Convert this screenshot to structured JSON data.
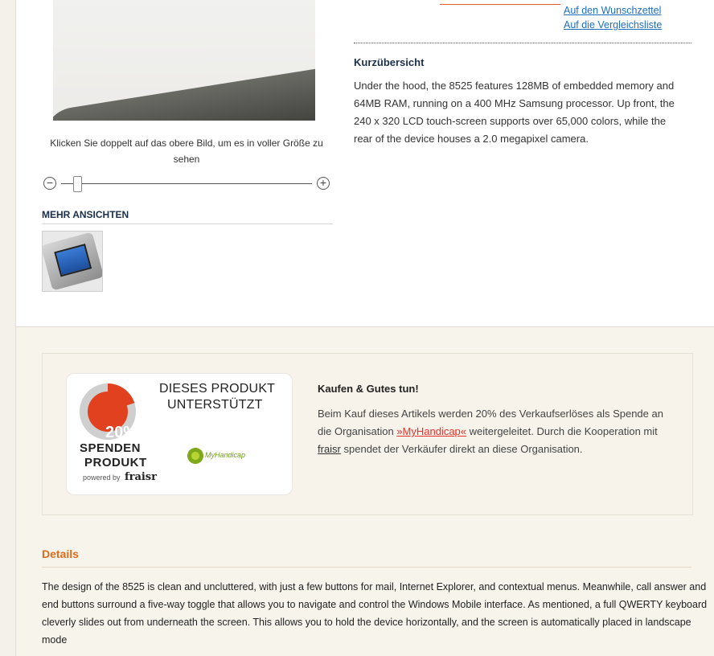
{
  "media": {
    "zoom_hint": "Klicken Sie doppelt auf das obere Bild, um es in voller Größe zu sehen",
    "zoom_out_symbol": "−",
    "zoom_in_symbol": "+",
    "zoom_level": 0.05,
    "more_views_label": "MEHR ANSICHTEN"
  },
  "product_links": {
    "wishlist": "Auf den Wunschzettel",
    "compare": "Auf die Vergleichsliste"
  },
  "overview": {
    "title": "Kurzübersicht",
    "text": "Under the hood, the 8525 features 128MB of embedded memory and 64MB RAM, running on a 400 MHz Samsung processor. Up front, the 240 x 320 LCD touch-screen supports over 65,000 colors, while the rear of the device houses a 2.0 megapixel camera."
  },
  "donation": {
    "badge": {
      "percent": "20%",
      "line1": "SPENDEN",
      "line2": "PRODUKT",
      "powered_by": "powered by",
      "brand": "fraisr",
      "header_line1": "DIESES PRODUKT",
      "header_line2": "UNTERSTÜTZT",
      "org_logo_text": "MyHandicap"
    },
    "title": "Kaufen & Gutes tun!",
    "text_part1": "Beim Kauf dieses Artikels werden 20% des Verkaufserlöses als Spende an die Organisation",
    "org_link": "»MyHandicap«",
    "text_part2": "weitergeleitet. Durch die Kooperation mit",
    "fraisr_link": "fraisr",
    "text_part3": "spendet der Verkäufer direkt an diese Organisation."
  },
  "details": {
    "title": "Details",
    "text": "The design of the 8525 is clean and uncluttered, with just a few buttons for mail, Internet Explorer, and contextual menus. Meanwhile, call answer and end buttons surround a five-way toggle that allows you to navigate and control the Windows Mobile interface. As mentioned, a full QWERTY keyboard cleverly slides out from underneath the screen. This allows you to hold the device horizontally, and the screen is automatically placed in landscape mode"
  },
  "colors": {
    "accent_orange": "#e06b1d",
    "link_blue": "#1e6fc0",
    "donation_red": "#e2411f",
    "panel_beige": "#f7f4ec"
  }
}
